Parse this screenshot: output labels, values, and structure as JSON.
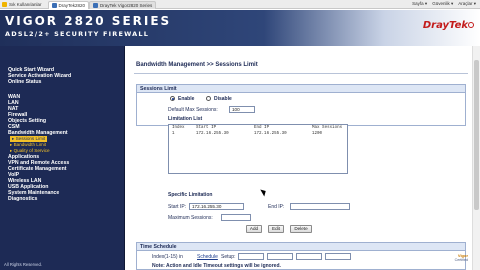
{
  "browser": {
    "favorites": "Sık Kullanılanlar",
    "tab_active": "DrayTek2820",
    "tab_inactive": "DrayTek Vigor2820 Series",
    "tools": [
      "Sayfa ▾",
      "Güvenlik ▾",
      "Araçlar ▾"
    ]
  },
  "header": {
    "model": "VIGOR 2820 SERIES",
    "subtitle": "ADSL2/2+ SECURITY FIREWALL",
    "brand": "DrayTek"
  },
  "sidebar": {
    "items": [
      {
        "label": "Quick Start Wizard",
        "type": "main"
      },
      {
        "label": "Service Activation Wizard",
        "type": "main"
      },
      {
        "label": "Online Status",
        "type": "main"
      },
      {
        "label": "WAN",
        "type": "main"
      },
      {
        "label": "LAN",
        "type": "main"
      },
      {
        "label": "NAT",
        "type": "main"
      },
      {
        "label": "Firewall",
        "type": "main"
      },
      {
        "label": "Objects Setting",
        "type": "main"
      },
      {
        "label": "CSM",
        "type": "main"
      },
      {
        "label": "Bandwidth Management",
        "type": "main"
      },
      {
        "label": "▸ Sessions Limit",
        "type": "sub-active"
      },
      {
        "label": "▸ Bandwidth Limit",
        "type": "sub"
      },
      {
        "label": "▸ Quality of Service",
        "type": "sub"
      },
      {
        "label": "Applications",
        "type": "main"
      },
      {
        "label": "VPN and Remote Access",
        "type": "main"
      },
      {
        "label": "Certificate Management",
        "type": "main"
      },
      {
        "label": "VoIP",
        "type": "main"
      },
      {
        "label": "Wireless LAN",
        "type": "main"
      },
      {
        "label": "USB Application",
        "type": "main"
      },
      {
        "label": "System Maintenance",
        "type": "main"
      },
      {
        "label": "Diagnostics",
        "type": "main"
      }
    ],
    "footer": "All Rights Reserved."
  },
  "main": {
    "title": "Bandwidth Management >> Sessions Limit",
    "sessions_limit": {
      "heading": "Sessions Limit",
      "enable_label": "Enable",
      "disable_label": "Disable",
      "enable_selected": true,
      "default_max_label": "Default Max Sessions:",
      "default_max_value": "100",
      "limitation_list_label": "Limitation List",
      "list_columns": [
        "Index",
        "Start IP",
        "End IP",
        "Max Sessions"
      ],
      "list_rows": [
        [
          "1",
          "172.16.255.30",
          "172.16.255.30",
          "1200"
        ]
      ]
    },
    "specific": {
      "heading": "Specific Limitation",
      "start_ip_label": "Start IP:",
      "start_ip_value": "172.16.255.30",
      "end_ip_label": "End IP:",
      "end_ip_value": "",
      "max_sessions_label": "Maximum Sessions:",
      "max_sessions_value": "",
      "add_label": "Add",
      "edit_label": "Edit",
      "delete_label": "Delete"
    },
    "schedule": {
      "heading": "Time Schedule",
      "index_label": "Index(1-15) in",
      "schedule_link": "Schedule",
      "setup_label": "Setup:",
      "note": "Note: Action and Idle Timeout settings will be ignored."
    },
    "corner_logo_line1": "Vigor",
    "corner_logo_line2": "Certified"
  },
  "colors": {
    "sidebar_bg": "#1d2a55",
    "sub_item": "#f2c029",
    "brand_red": "#c31b1b"
  }
}
